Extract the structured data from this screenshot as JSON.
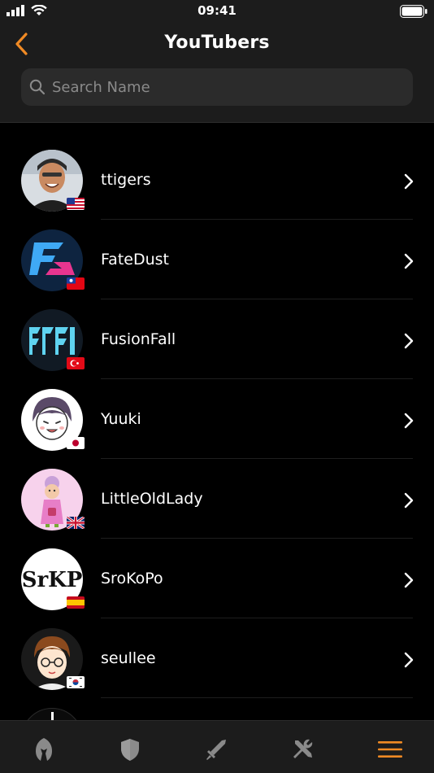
{
  "status_bar": {
    "time": "09:41"
  },
  "header": {
    "title": "YouTubers"
  },
  "search": {
    "placeholder": "Search Name"
  },
  "list": {
    "items": [
      {
        "name": "ttigers",
        "flag": "us"
      },
      {
        "name": "FateDust",
        "flag": "tw"
      },
      {
        "name": "FusionFall",
        "flag": "tr"
      },
      {
        "name": "Yuuki",
        "flag": "jp"
      },
      {
        "name": "LittleOldLady",
        "flag": "gb"
      },
      {
        "name": "SroKoPo",
        "flag": "es"
      },
      {
        "name": "seullee",
        "flag": "kr"
      }
    ],
    "avatar_texts": {
      "srokopo": "SrKP"
    }
  },
  "tabbar": {
    "tabs": [
      {
        "icon": "helmet-icon",
        "active": false
      },
      {
        "icon": "shield-icon",
        "active": false
      },
      {
        "icon": "sword-icon",
        "active": false
      },
      {
        "icon": "tools-icon",
        "active": false
      },
      {
        "icon": "menu-icon",
        "active": true
      }
    ]
  },
  "colors": {
    "accent": "#f08a24",
    "background": "#000000",
    "bar": "#1c1c1c",
    "search_bg": "#2b2b2b"
  }
}
